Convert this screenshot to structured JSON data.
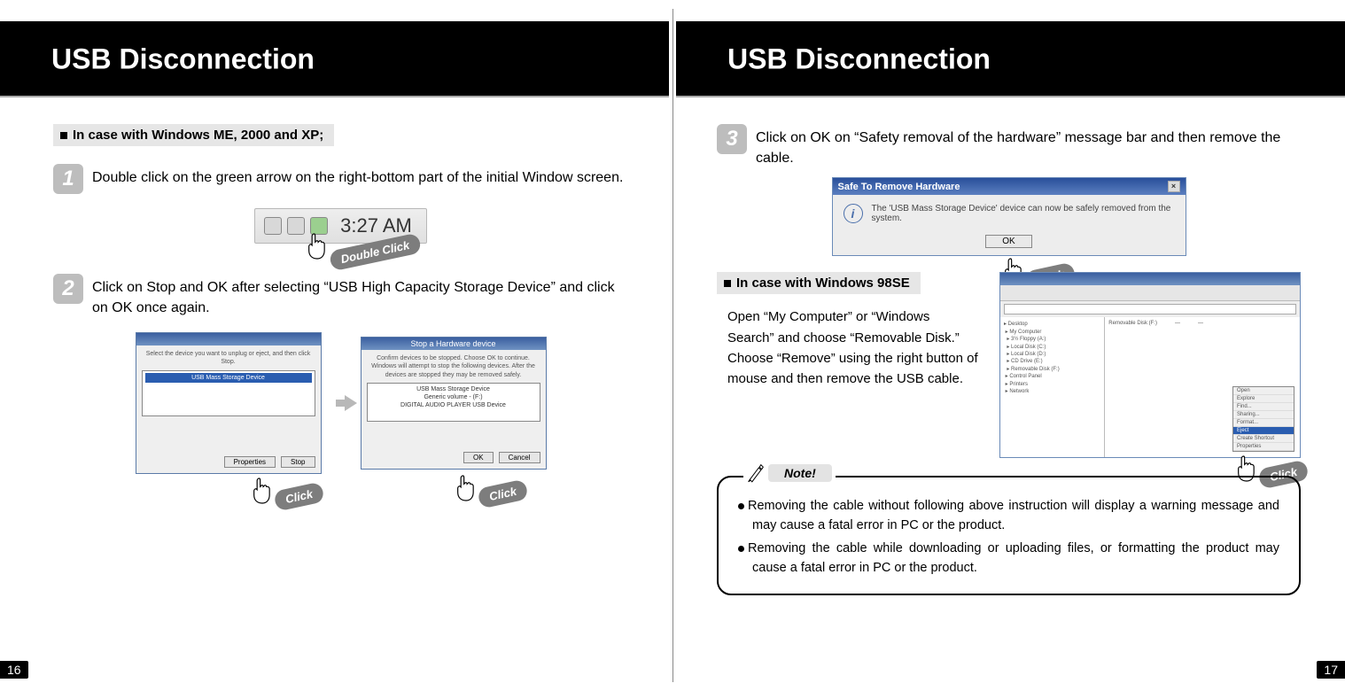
{
  "left": {
    "title": "USB Disconnection",
    "subhead": "In case with Windows ME, 2000 and XP;",
    "step1_num": "1",
    "step1_text": "Double click on the green arrow on the right-bottom part of the initial Window screen.",
    "clock_text": "3:27 AM",
    "dbl_click_label": "Double Click",
    "step2_num": "2",
    "step2_pre": "Click on Stop and OK after selecting ",
    "step2_q": "“USB High Capacity Storage Device”",
    "step2_post": " and click on OK once again.",
    "click_label_a": "Click",
    "click_label_b": "Click",
    "page_num": "16",
    "dlg1_line": "USB Mass Storage Device",
    "dlg1_btn1": "Properties",
    "dlg1_btn2": "Stop",
    "dlg2_line1": "USB Mass Storage Device",
    "dlg2_line2": "Generic volume - (F:)",
    "dlg2_line3": "DIGITAL AUDIO PLAYER USB Device",
    "dlg2_btn1": "OK",
    "dlg2_btn2": "Cancel"
  },
  "right": {
    "title": "USB Disconnection",
    "step3_num": "3",
    "step3_pre": "Click on OK on ",
    "step3_q": "“Safety removal of the hardware”",
    "step3_post": " message bar and then remove the cable.",
    "safe_dlg_title": "Safe To Remove Hardware",
    "safe_dlg_msg": "The 'USB Mass Storage Device' device can now be safely removed from the system.",
    "ok_label": "OK",
    "click_label_c": "Click",
    "subhead98": "In case with Windows 98SE",
    "para98": "Open “My Computer” or “Windows Search” and choose “Removable Disk.” Choose “Remove” using the right button of mouse and then remove the USB cable.",
    "ctx_items": [
      "Open",
      "Explore",
      "Find...",
      "Sharing...",
      "Format...",
      "Eject",
      "Create Shortcut",
      "Properties"
    ],
    "ctx_hl": "Eject",
    "click_label_d": "Click",
    "note_label": "Note!",
    "note1": "Removing the cable without following above instruction will display a warning message and may cause a fatal error in PC or the product.",
    "note2": "Removing the cable while downloading or uploading files, or formatting the product may cause a fatal error in PC or the product.",
    "page_num": "17"
  }
}
